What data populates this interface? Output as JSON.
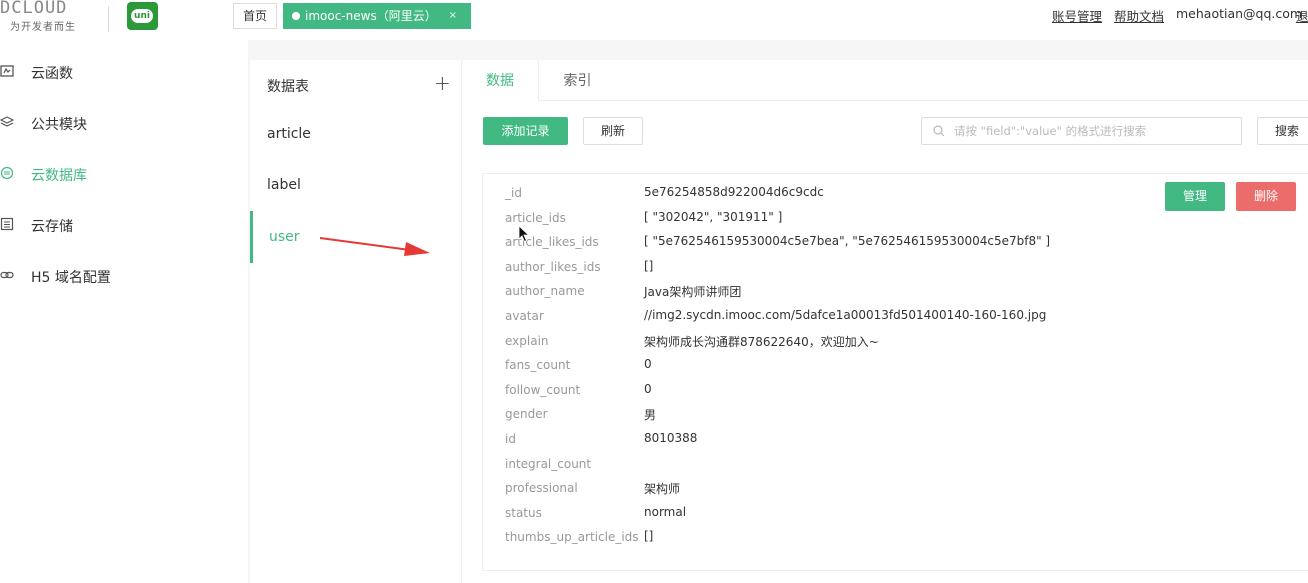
{
  "header": {
    "logo_text": "DCLOUD",
    "logo_subtitle": "为开发者而生",
    "uni_logo_text": "uni",
    "tabs": [
      {
        "label": "首页"
      },
      {
        "label": "imooc-news（阿里云）",
        "close": "×"
      }
    ],
    "links": [
      "账号管理",
      "帮助文档"
    ],
    "email": "mehaotian@qq.com",
    "overflow_text": "退"
  },
  "sidebar": {
    "items": [
      {
        "label": "云函数",
        "icon": "cloud-function-icon"
      },
      {
        "label": "公共模块",
        "icon": "layers-icon"
      },
      {
        "label": "云数据库",
        "icon": "database-icon",
        "active": true
      },
      {
        "label": "云存储",
        "icon": "storage-icon"
      },
      {
        "label": "H5 域名配置",
        "icon": "link-icon"
      }
    ]
  },
  "tables": {
    "header": "数据表",
    "add": "+",
    "items": [
      "article",
      "label",
      "user"
    ],
    "active": "user"
  },
  "main": {
    "tabs": [
      "数据",
      "索引"
    ],
    "active_tab": "数据",
    "add_record": "添加记录",
    "refresh": "刷新",
    "search_placeholder": "请按 \"field\":\"value\" 的格式进行搜索",
    "search": "搜索"
  },
  "record": {
    "manage": "管理",
    "delete": "删除",
    "fields": [
      {
        "key": "_id",
        "value": "5e76254858d922004d6c9cdc"
      },
      {
        "key": "article_ids",
        "value": "[ \"302042\", \"301911\" ]"
      },
      {
        "key": "article_likes_ids",
        "value": "[ \"5e762546159530004c5e7bea\", \"5e762546159530004c5e7bf8\" ]"
      },
      {
        "key": "author_likes_ids",
        "value": "[]"
      },
      {
        "key": "author_name",
        "value": "Java架构师讲师团"
      },
      {
        "key": "avatar",
        "value": "//img2.sycdn.imooc.com/5dafce1a00013fd501400140-160-160.jpg"
      },
      {
        "key": "explain",
        "value": "架构师成长沟通群878622640，欢迎加入~"
      },
      {
        "key": "fans_count",
        "value": "0"
      },
      {
        "key": "follow_count",
        "value": "0"
      },
      {
        "key": "gender",
        "value": "男"
      },
      {
        "key": "id",
        "value": "8010388"
      },
      {
        "key": "integral_count",
        "value": ""
      },
      {
        "key": "professional",
        "value": "架构师"
      },
      {
        "key": "status",
        "value": "normal"
      },
      {
        "key": "thumbs_up_article_ids",
        "value": "[]"
      }
    ]
  },
  "colors": {
    "accent": "#42b983",
    "danger": "#ec6b6b",
    "annotation_arrow": "#e53935"
  }
}
